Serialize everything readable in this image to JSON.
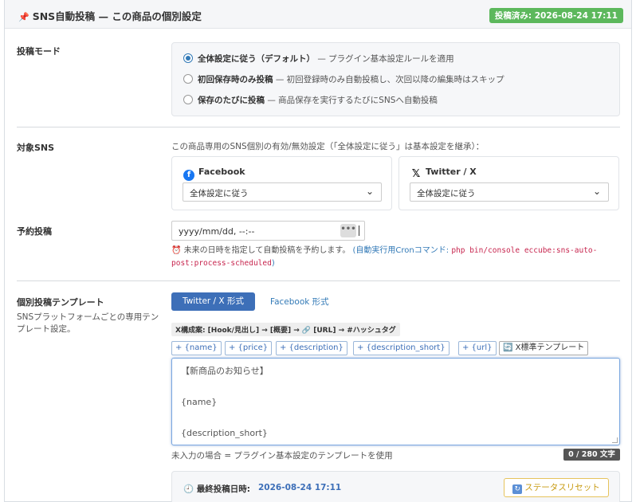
{
  "header": {
    "title": "SNS自動投稿 — この商品の個別設定",
    "pin_icon": "pin-icon",
    "badge": "投稿済み: 2026-08-24 17:11",
    "badge_color": "#5cb85c"
  },
  "mode": {
    "label": "投稿モード",
    "options": [
      {
        "title": "全体設定に従う（デフォルト）",
        "desc": "— プラグイン基本設定ルールを適用",
        "selected": true
      },
      {
        "title": "初回保存時のみ投稿",
        "desc": "— 初回登録時のみ自動投稿し、次回以降の編集時はスキップ",
        "selected": false
      },
      {
        "title": "保存のたびに投稿",
        "desc": "— 商品保存を実行するたびにSNSへ自動投稿",
        "selected": false
      }
    ]
  },
  "target_sns": {
    "label": "対象SNS",
    "hint": "この商品専用のSNS個別の有効/無効設定（「全体設定に従う」は基本設定を継承）：",
    "cards": [
      {
        "name": "Facebook",
        "icon": "facebook-icon",
        "select_value": "全体設定に従う"
      },
      {
        "name": "Twitter / X",
        "icon": "x-icon",
        "select_value": "全体設定に従う"
      }
    ]
  },
  "schedule": {
    "label": "予約投稿",
    "value": "yyyy/mm/dd, --:--",
    "calendar_icon": "•••",
    "help_text": "未来の日時を指定して自動投稿を予約します。",
    "help_link": "(自動実行用Cronコマンド:",
    "help_code": "php bin/console eccube:sns-auto-post:process-scheduled",
    "help_close": ")"
  },
  "template": {
    "label": "個別投稿テンプレート",
    "sublabel": "SNSプラットフォームごとの専用テンプレート設定。",
    "tabs": [
      {
        "label": "Twitter / X 形式",
        "active": true
      },
      {
        "label": "Facebook 形式",
        "active": false
      }
    ],
    "structure": "X構成案: [Hook/見出し] → [概要] → 🔗 [URL] → #ハッシュタグ",
    "tokens": [
      "+ {name}",
      "+ {price}",
      "+ {description}",
      "+ {description_short}",
      "+ {url}"
    ],
    "std_button": "X標準テンプレート",
    "text": "【新商品のお知らせ】\n\n{name}\n\n{description_short}",
    "help": "未入力の場合 = プラグイン基本設定のテンプレートを使用",
    "counter": "0 / 280 文字"
  },
  "last_post": {
    "label": "最終投稿日時:",
    "value": "2026-08-24 17:11",
    "reset_button": "ステータスリセット",
    "clock_icon": "clock-icon"
  }
}
